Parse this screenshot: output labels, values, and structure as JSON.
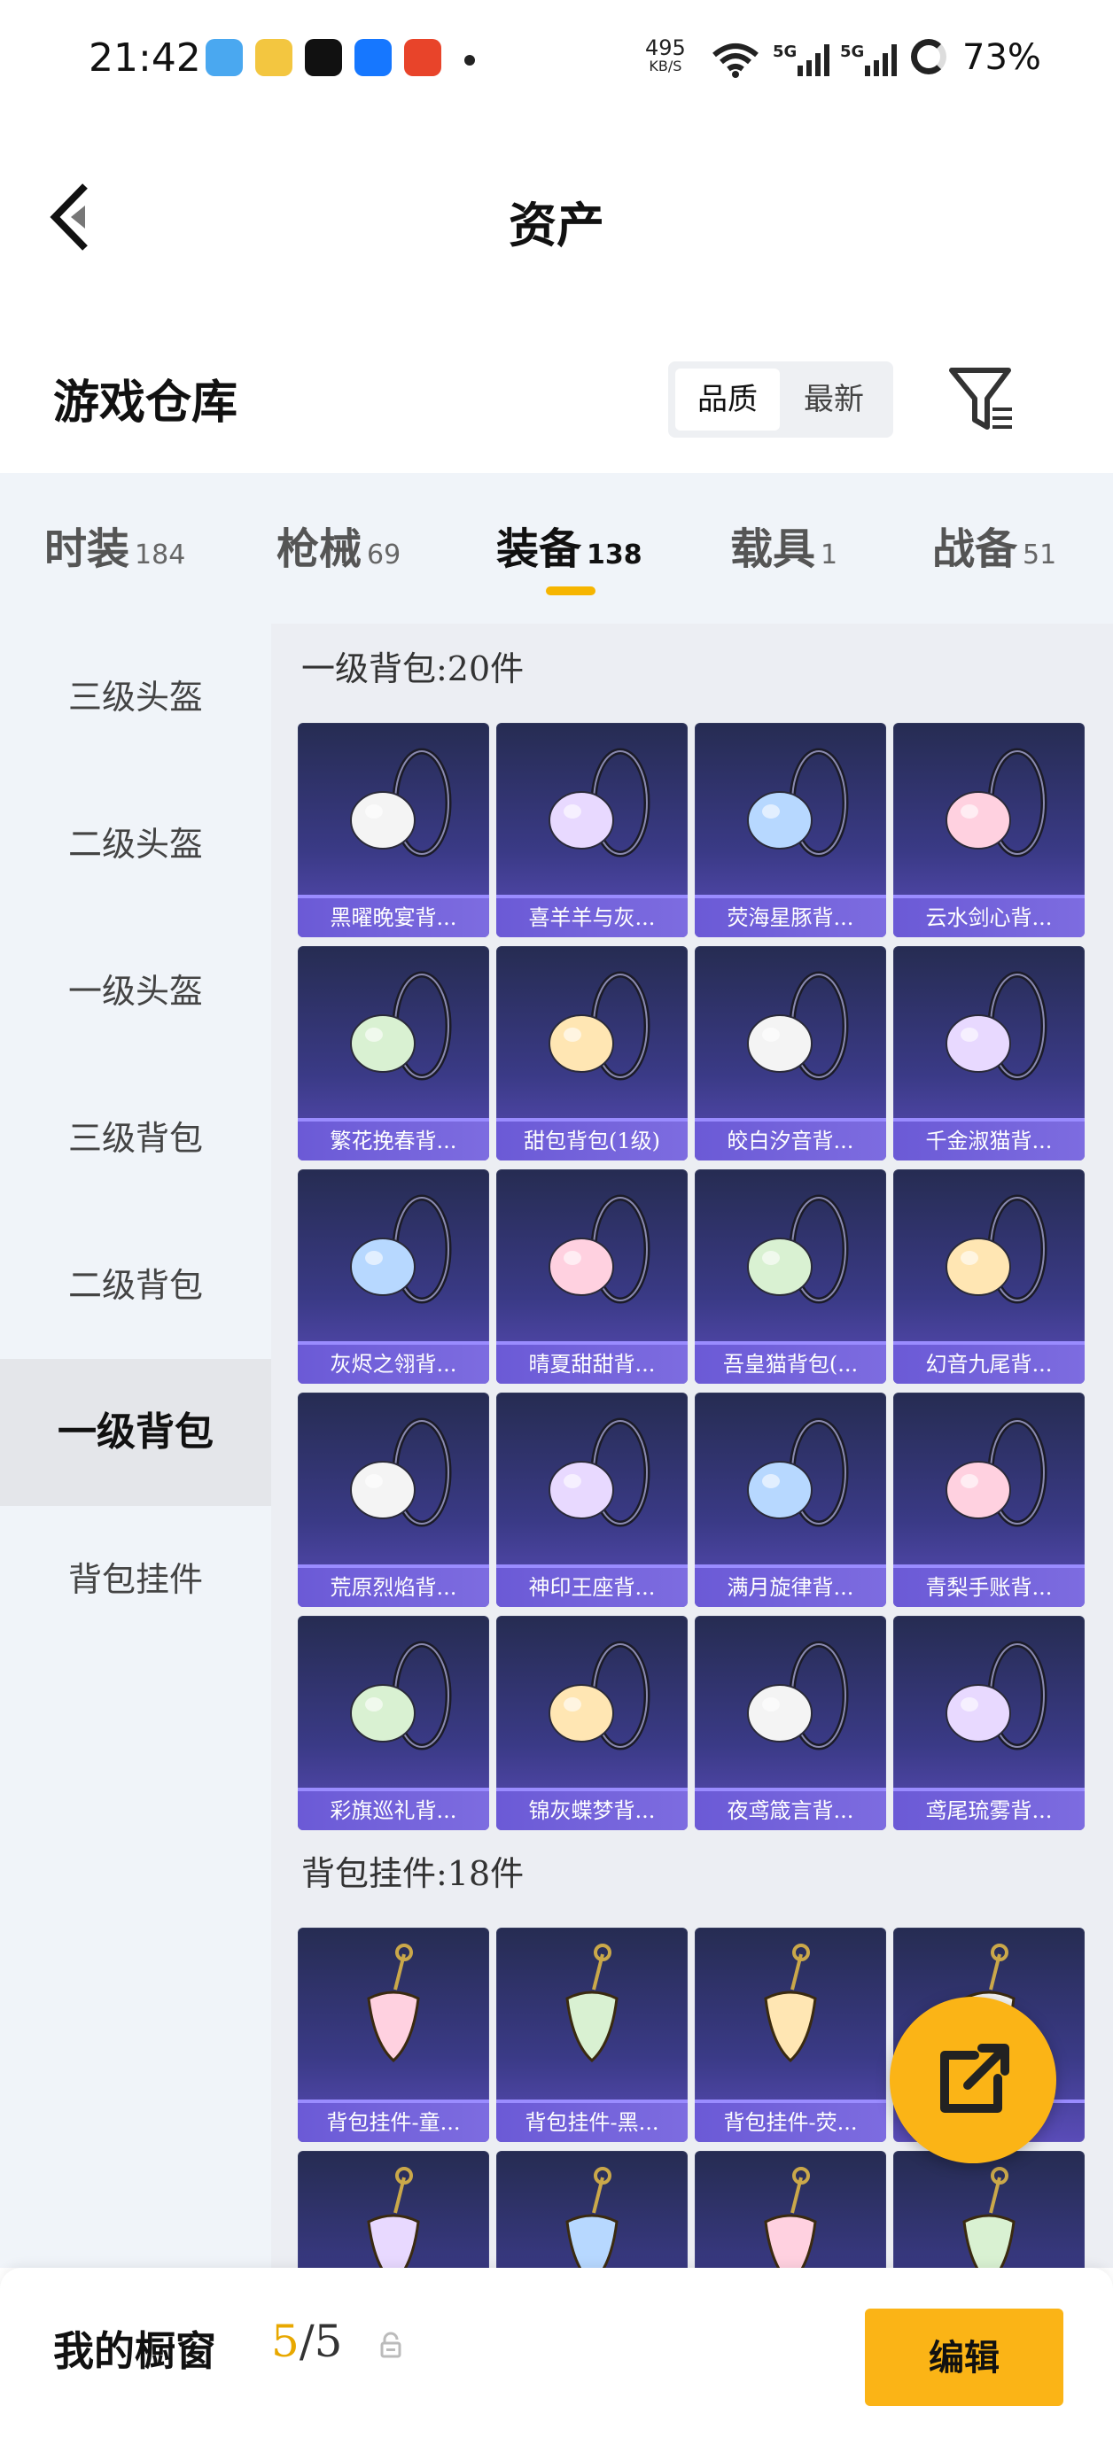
{
  "status_bar": {
    "time": "21:42",
    "net_speed": "495",
    "net_unit": "KB/S",
    "signal_1": "5G",
    "signal_2": "5G",
    "battery": "73%"
  },
  "header": {
    "title": "资产",
    "back_icon": "chevron-left-icon"
  },
  "repository": {
    "title": "游戏仓库",
    "sort_options": [
      "品质",
      "最新"
    ],
    "filter_icon": "filter-icon"
  },
  "categories": [
    {
      "label": "时装",
      "count": "184"
    },
    {
      "label": "枪械",
      "count": "69"
    },
    {
      "label": "装备",
      "count": "138",
      "active": true
    },
    {
      "label": "载具",
      "count": "1"
    },
    {
      "label": "战备",
      "count": "51"
    }
  ],
  "sidebar": {
    "items": [
      "三级头盔",
      "二级头盔",
      "一级头盔",
      "三级背包",
      "二级背包",
      "一级背包",
      "背包挂件"
    ],
    "active": "一级背包"
  },
  "sections": [
    {
      "title": "一级背包:20件",
      "items": [
        "黑曜晚宴背...",
        "喜羊羊与灰...",
        "荧海星豚背...",
        "云水剑心背...",
        "繁花挽春背...",
        "甜包背包(1级)",
        "皎白汐音背...",
        "千金淑猫背...",
        "灰烬之翎背...",
        "晴夏甜甜背...",
        "吾皇猫背包(...",
        "幻音九尾背...",
        "荒原烈焰背...",
        "神印王座背...",
        "满月旋律背...",
        "青梨手账背...",
        "彩旗巡礼背...",
        "锦灰蝶梦背...",
        "夜鸢箴言背...",
        "鸢尾琉雾背..."
      ]
    },
    {
      "title": "背包挂件:18件",
      "items": [
        "背包挂件-童...",
        "背包挂件-黑...",
        "背包挂件-荧...",
        "",
        "",
        "",
        "",
        ""
      ]
    }
  ],
  "fab": {
    "icon": "share-external-icon"
  },
  "bottom_bar": {
    "label": "我的橱窗",
    "current": "5",
    "total": "/5",
    "lock_icon": "lock-icon",
    "edit_label": "编辑"
  },
  "colors": {
    "accent": "#fbb416",
    "card_bg": "#3a3a86",
    "card_label": "#6b5ad6"
  }
}
